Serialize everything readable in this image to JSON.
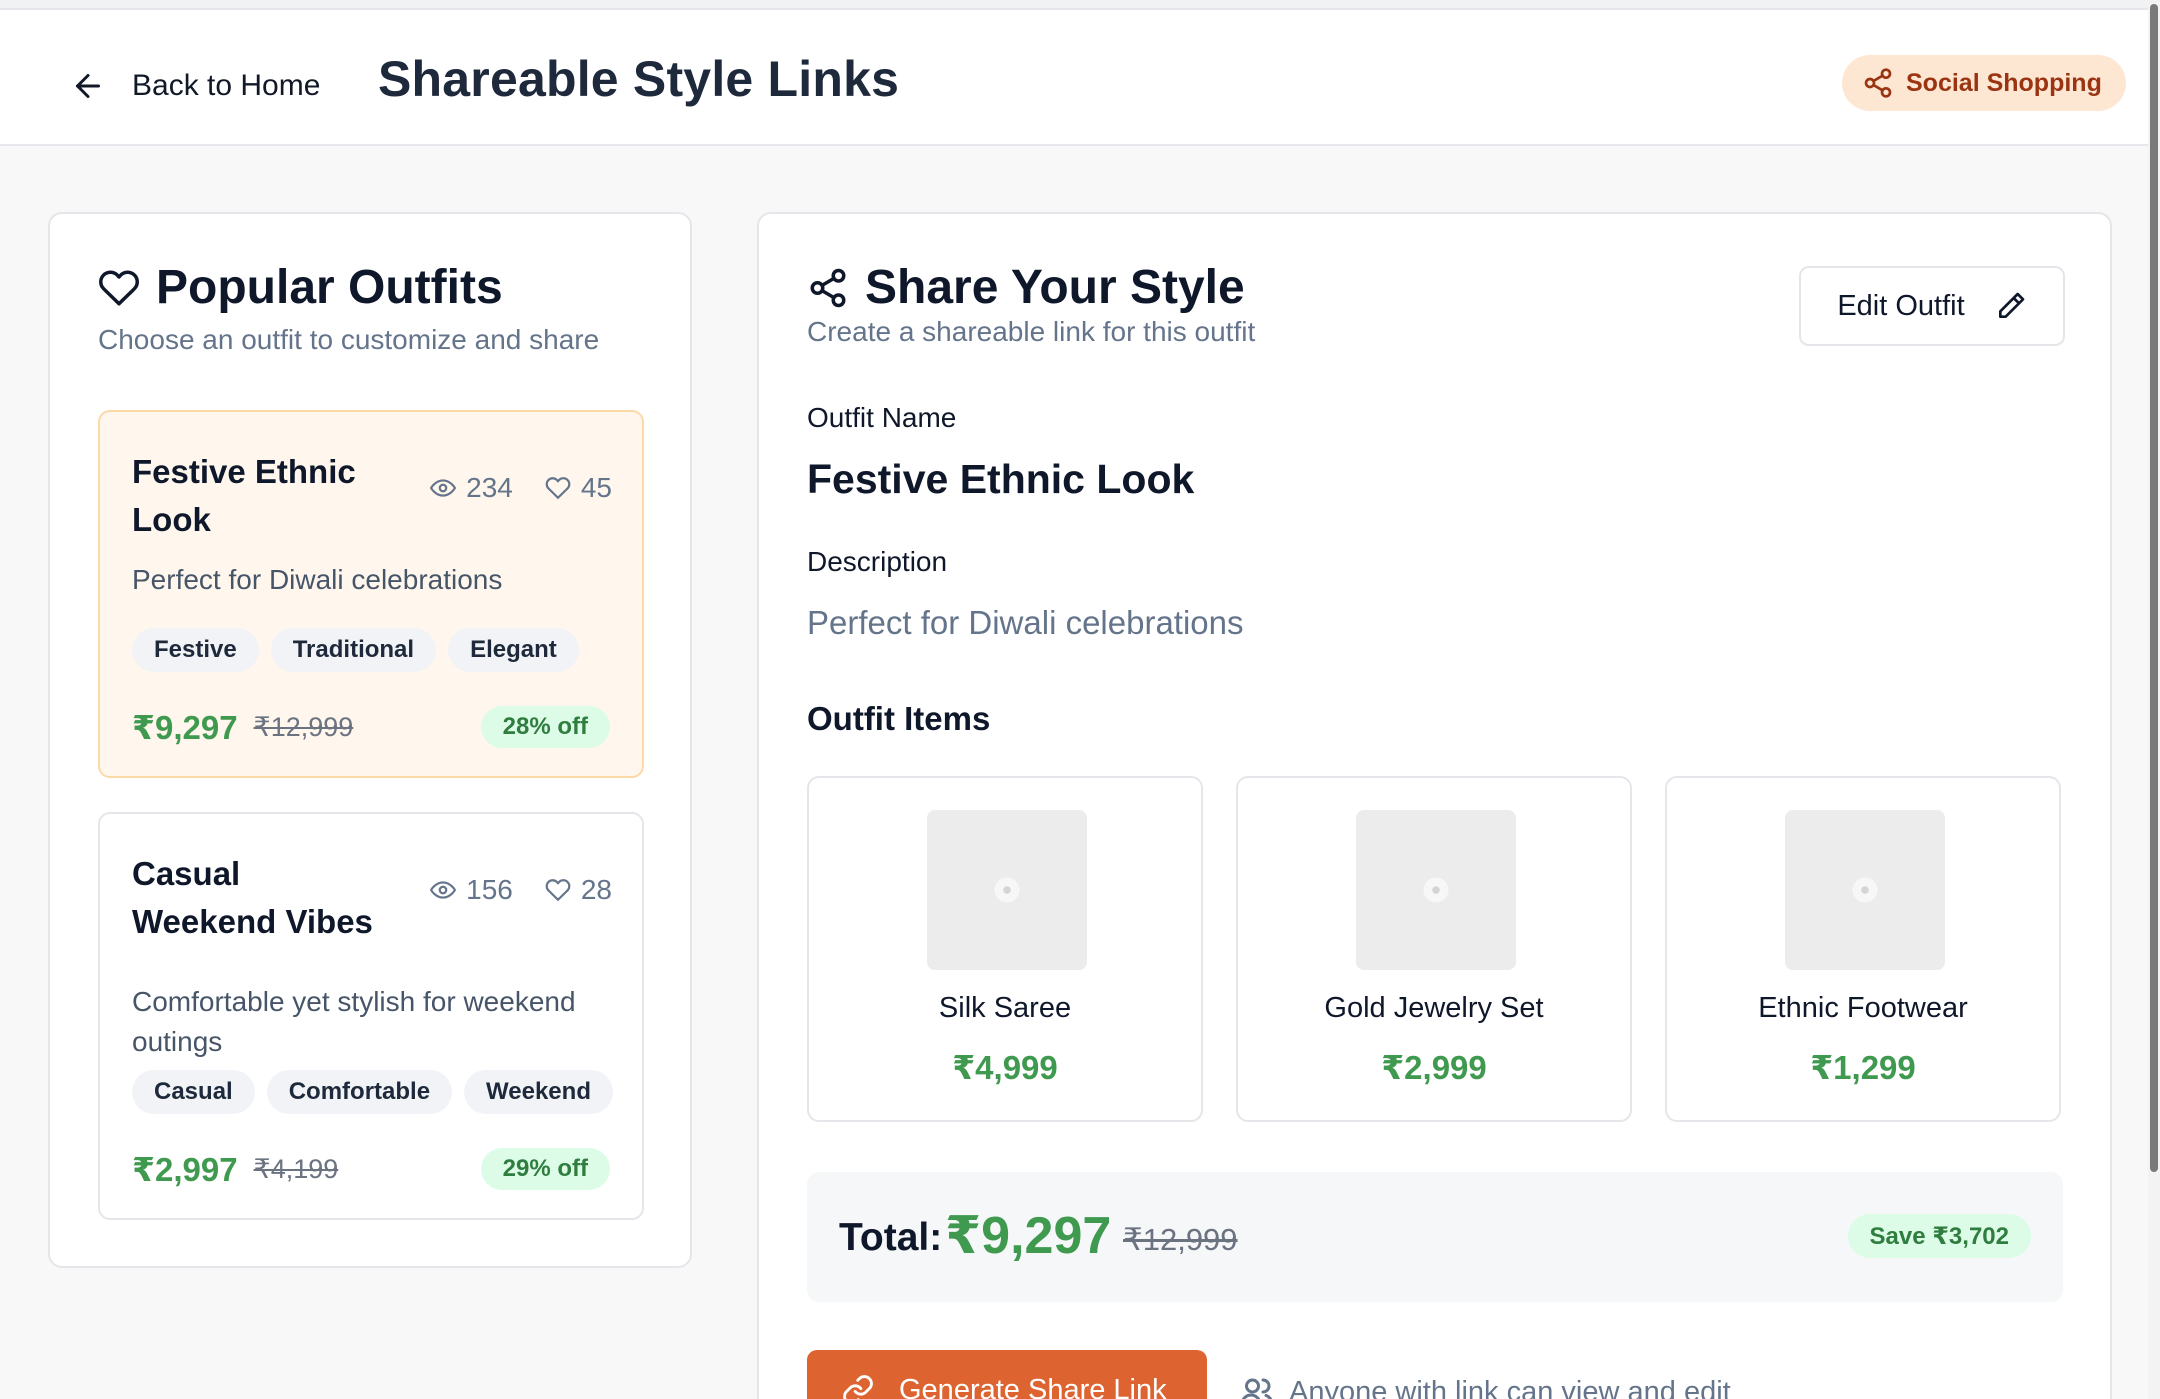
{
  "header": {
    "back_label": "Back to Home",
    "title": "Shareable Style Links",
    "badge": "Social Shopping"
  },
  "popular": {
    "title": "Popular Outfits",
    "subtitle": "Choose an outfit to customize and share",
    "outfits": [
      {
        "name": "Festive Ethnic Look",
        "views": "234",
        "likes": "45",
        "description": "Perfect for Diwali celebrations",
        "tags": [
          "Festive",
          "Traditional",
          "Elegant"
        ],
        "price": "₹9,297",
        "original_price": "₹12,999",
        "discount": "28% off",
        "selected": true
      },
      {
        "name": "Casual Weekend Vibes",
        "views": "156",
        "likes": "28",
        "description": "Comfortable yet stylish for weekend outings",
        "tags": [
          "Casual",
          "Comfortable",
          "Weekend"
        ],
        "price": "₹2,997",
        "original_price": "₹4,199",
        "discount": "29% off",
        "selected": false
      }
    ]
  },
  "share": {
    "title": "Share Your Style",
    "subtitle": "Create a shareable link for this outfit",
    "edit_label": "Edit Outfit",
    "name_label": "Outfit Name",
    "name_value": "Festive Ethnic Look",
    "desc_label": "Description",
    "desc_value": "Perfect for Diwali celebrations",
    "items_title": "Outfit Items",
    "items": [
      {
        "name": "Silk Saree",
        "price": "₹4,999"
      },
      {
        "name": "Gold Jewelry Set",
        "price": "₹2,999"
      },
      {
        "name": "Ethnic Footwear",
        "price": "₹1,299"
      }
    ],
    "total_label": "Total:",
    "total_price": "₹9,297",
    "total_original": "₹12,999",
    "save_label": "Save ₹3,702",
    "generate_label": "Generate Share Link",
    "access_note": "Anyone with link can view and edit"
  },
  "colors": {
    "accent": "#dd6430",
    "price_green": "#3f9a4f",
    "selected_bg": "#fff7ed",
    "badge_bg": "#fde7d3"
  },
  "icons": [
    "arrow-left-icon",
    "share-icon",
    "heart-icon",
    "eye-icon",
    "pencil-icon",
    "image-placeholder-icon",
    "link-icon",
    "users-icon"
  ]
}
